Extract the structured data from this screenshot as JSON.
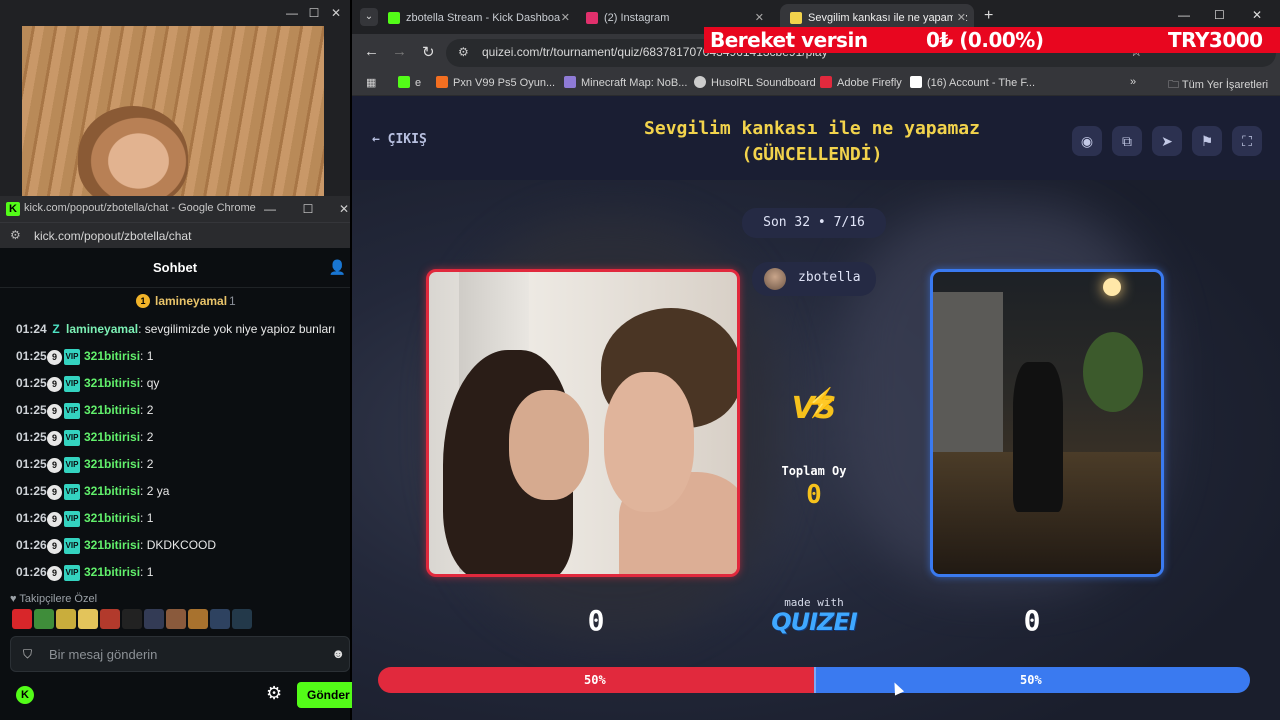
{
  "chat_window": {
    "title": "kick.com/popout/zbotella/chat - Google Chrome",
    "url": "kick.com/popout/zbotella/chat",
    "header": "Sohbet",
    "pinned": {
      "name": "lamineyamal",
      "count": "1"
    },
    "messages": [
      {
        "time": "01:24",
        "user": "lamineyamal",
        "text": "sevgilimizde yok niye yapioz bunları"
      },
      {
        "time": "01:25",
        "badge": "9",
        "user": "321bitirisi",
        "text": "1"
      },
      {
        "time": "01:25",
        "badge": "9",
        "user": "321bitirisi",
        "text": "qy"
      },
      {
        "time": "01:25",
        "badge": "9",
        "user": "321bitirisi",
        "text": "2"
      },
      {
        "time": "01:25",
        "badge": "9",
        "user": "321bitirisi",
        "text": "2"
      },
      {
        "time": "01:25",
        "badge": "9",
        "user": "321bitirisi",
        "text": "2"
      },
      {
        "time": "01:25",
        "badge": "9",
        "user": "321bitirisi",
        "text": "2 ya"
      },
      {
        "time": "01:26",
        "badge": "9",
        "user": "321bitirisi",
        "text": "1"
      },
      {
        "time": "01:26",
        "badge": "9",
        "user": "321bitirisi",
        "text": "DKDKCOOD"
      },
      {
        "time": "01:26",
        "badge": "9",
        "user": "321bitirisi",
        "text": "1"
      }
    ],
    "followers_label": "Takipçilere Özel",
    "input_placeholder": "Bir mesaj gönderin",
    "send_label": "Gönder"
  },
  "browser": {
    "tabs": [
      {
        "label": "zbotella Stream - Kick Dashboa",
        "icon_color": "#53fc18"
      },
      {
        "label": "(2) Instagram",
        "icon_color": "#e1306c"
      },
      {
        "label": "Sevgilim kankası ile ne yapamaz",
        "icon_color": "#f2d34c"
      }
    ],
    "url": "quizei.com/tr/tournament/quiz/6837817070434961413cbe91/play",
    "bookmarks": [
      {
        "label": "e",
        "icon_color": "#53fc18"
      },
      {
        "label": "Pxn V99 Ps5 Oyun...",
        "icon_color": "#f36f21"
      },
      {
        "label": "Minecraft Map: NoB...",
        "icon_color": "#8f7bd6"
      },
      {
        "label": "HusolRL Soundboard",
        "icon_color": "#cccccc"
      },
      {
        "label": "Adobe Firefly",
        "icon_color": "#e1293d"
      },
      {
        "label": "(16) Account - The F...",
        "icon_color": "#ffffff"
      }
    ],
    "all_bookmarks": "Tüm Yer İşaretleri"
  },
  "ticker": {
    "left": "Bereket versin",
    "mid": "0₺ (0.00%)",
    "right": "TRY3000"
  },
  "quiz": {
    "exit_label": "← ÇIKIŞ",
    "title_line1": "Sevgilim kankası ile ne yapamaz",
    "title_line2": "(GÜNCELLENDİ)",
    "round": "Son 32 • 7/16",
    "host": "zbotella",
    "vs": "VS",
    "total_label": "Toplam Oy",
    "total_value": "0",
    "made_with": "made with",
    "brand": "QUIZEI",
    "score_left": "0",
    "score_right": "0",
    "percent_left": 50,
    "percent_right": 50,
    "percent_left_label": "50%",
    "percent_right_label": "50%",
    "colors": {
      "left": "#e1293d",
      "right": "#3a7af0",
      "accent": "#f2d34c"
    }
  }
}
